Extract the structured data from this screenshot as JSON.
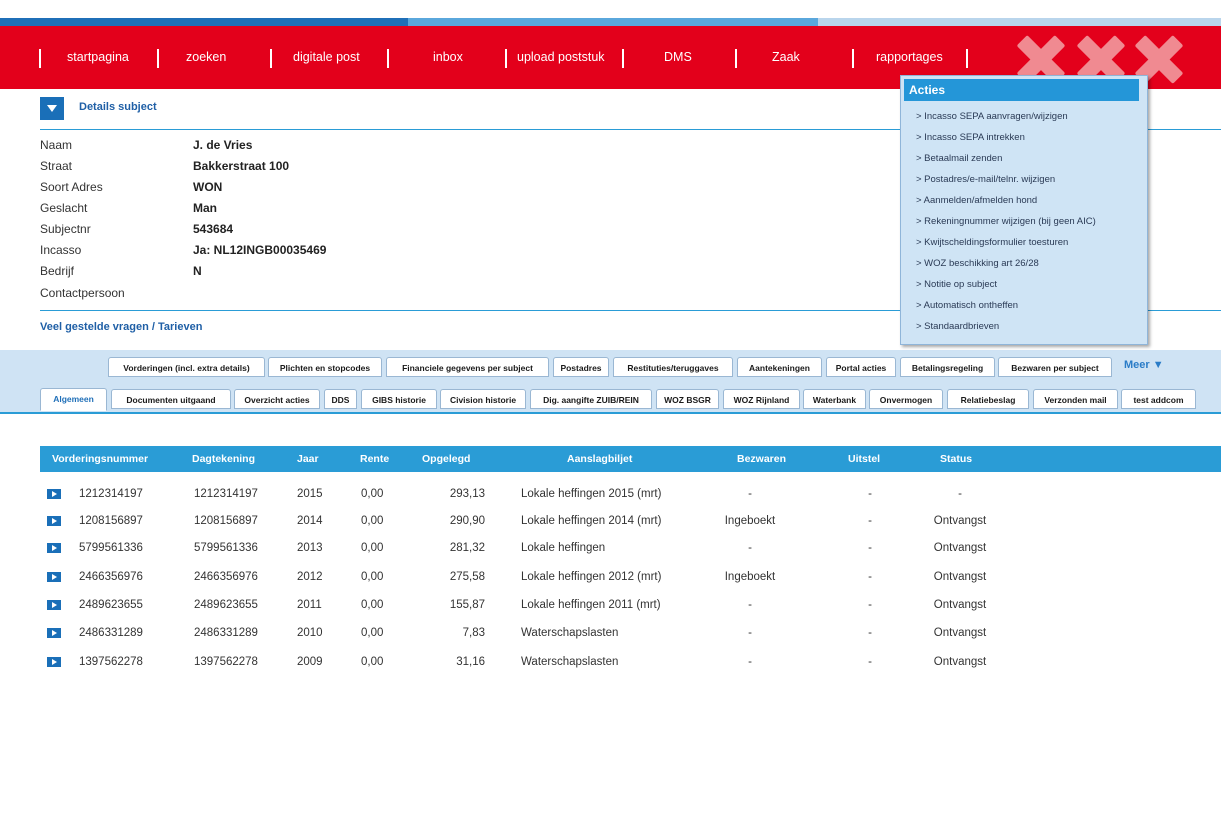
{
  "colors": {
    "nav_red": "#e3001b",
    "accent_blue": "#2a9cd6",
    "link_blue": "#1f5fa6",
    "panel_blue": "#cfe4f5"
  },
  "nav": {
    "items": [
      {
        "label": "startpagina"
      },
      {
        "label": "zoeken"
      },
      {
        "label": "digitale post"
      },
      {
        "label": "inbox"
      },
      {
        "label": "upload poststuk"
      },
      {
        "label": "DMS"
      },
      {
        "label": "Zaak"
      },
      {
        "label": "rapportages"
      }
    ],
    "logo": "amsterdam-xxx-logo"
  },
  "details": {
    "title": "Details subject",
    "toggle_icon": "chevron-down-icon",
    "fields": [
      {
        "label": "Naam",
        "value": "J. de Vries"
      },
      {
        "label": "Straat",
        "value": "Bakkerstraat 100"
      },
      {
        "label": "Soort Adres",
        "value": "WON"
      },
      {
        "label": "Geslacht",
        "value": "Man"
      },
      {
        "label": "Subjectnr",
        "value": "543684"
      },
      {
        "label": "Incasso",
        "value": "Ja: NL12INGB00035469"
      },
      {
        "label": "Bedrijf",
        "value": "N"
      },
      {
        "label": "Contactpersoon",
        "value": ""
      }
    ],
    "faq_link": "Veel gestelde vragen / Tarieven"
  },
  "actions": {
    "title": "Acties",
    "items": [
      "> Incasso SEPA aanvragen/wijzigen",
      "> Incasso SEPA intrekken",
      "> Betaalmail zenden",
      "> Postadres/e-mail/telnr. wijzigen",
      "> Aanmelden/afmelden hond",
      "> Rekeningnummer wijzigen (bij geen AIC)",
      "> Kwijtscheldingsformulier toesturen",
      "> WOZ beschikking art 26/28",
      "> Notitie op subject",
      "> Automatisch ontheffen",
      "> Standaardbrieven"
    ]
  },
  "tabs": {
    "row1": [
      "Vorderingen (incl. extra details)",
      "Plichten en stopcodes",
      "Financiele gegevens per subject",
      "Postadres",
      "Restituties/teruggaves",
      "Aantekeningen",
      "Portal acties",
      "Betalingsregeling",
      "Bezwaren per subject"
    ],
    "more": "Meer ▼",
    "row2": [
      "Algemeen",
      "Documenten uitgaand",
      "Overzicht acties",
      "DDS",
      "GIBS historie",
      "Civision historie",
      "Dig. aangifte ZUIB/REIN",
      "WOZ BSGR",
      "WOZ Rijnland",
      "Waterbank",
      "Onvermogen",
      "Relatiebeslag",
      "Verzonden mail",
      "test addcom"
    ],
    "active": "Algemeen"
  },
  "table": {
    "columns": [
      "Vorderingsnummer",
      "Dagtekening",
      "Jaar",
      "Rente",
      "Opgelegd",
      "Aanslagbiljet",
      "Bezwaren",
      "Uitstel",
      "Status"
    ],
    "rows": [
      [
        "1212314197",
        "1212314197",
        "2015",
        "0,00",
        "293,13",
        "Lokale heffingen 2015 (mrt)",
        "-",
        "-",
        "-"
      ],
      [
        "1208156897",
        "1208156897",
        "2014",
        "0,00",
        "290,90",
        "Lokale heffingen 2014 (mrt)",
        "Ingeboekt",
        "-",
        "Ontvangst"
      ],
      [
        "5799561336",
        "5799561336",
        "2013",
        "0,00",
        "281,32",
        "Lokale heffingen",
        "-",
        "-",
        "Ontvangst"
      ],
      [
        "2466356976",
        "2466356976",
        "2012",
        "0,00",
        "275,58",
        "Lokale heffingen 2012 (mrt)",
        "Ingeboekt",
        "-",
        "Ontvangst"
      ],
      [
        "2489623655",
        "2489623655",
        "2011",
        "0,00",
        "155,87",
        "Lokale heffingen 2011 (mrt)",
        "-",
        "-",
        "Ontvangst"
      ],
      [
        "2486331289",
        "2486331289",
        "2010",
        "0,00",
        "7,83",
        "Waterschapslasten",
        "-",
        "-",
        "Ontvangst"
      ],
      [
        "1397562278",
        "1397562278",
        "2009",
        "0,00",
        "31,16",
        "Waterschapslasten",
        "-",
        "-",
        "Ontvangst"
      ]
    ]
  }
}
